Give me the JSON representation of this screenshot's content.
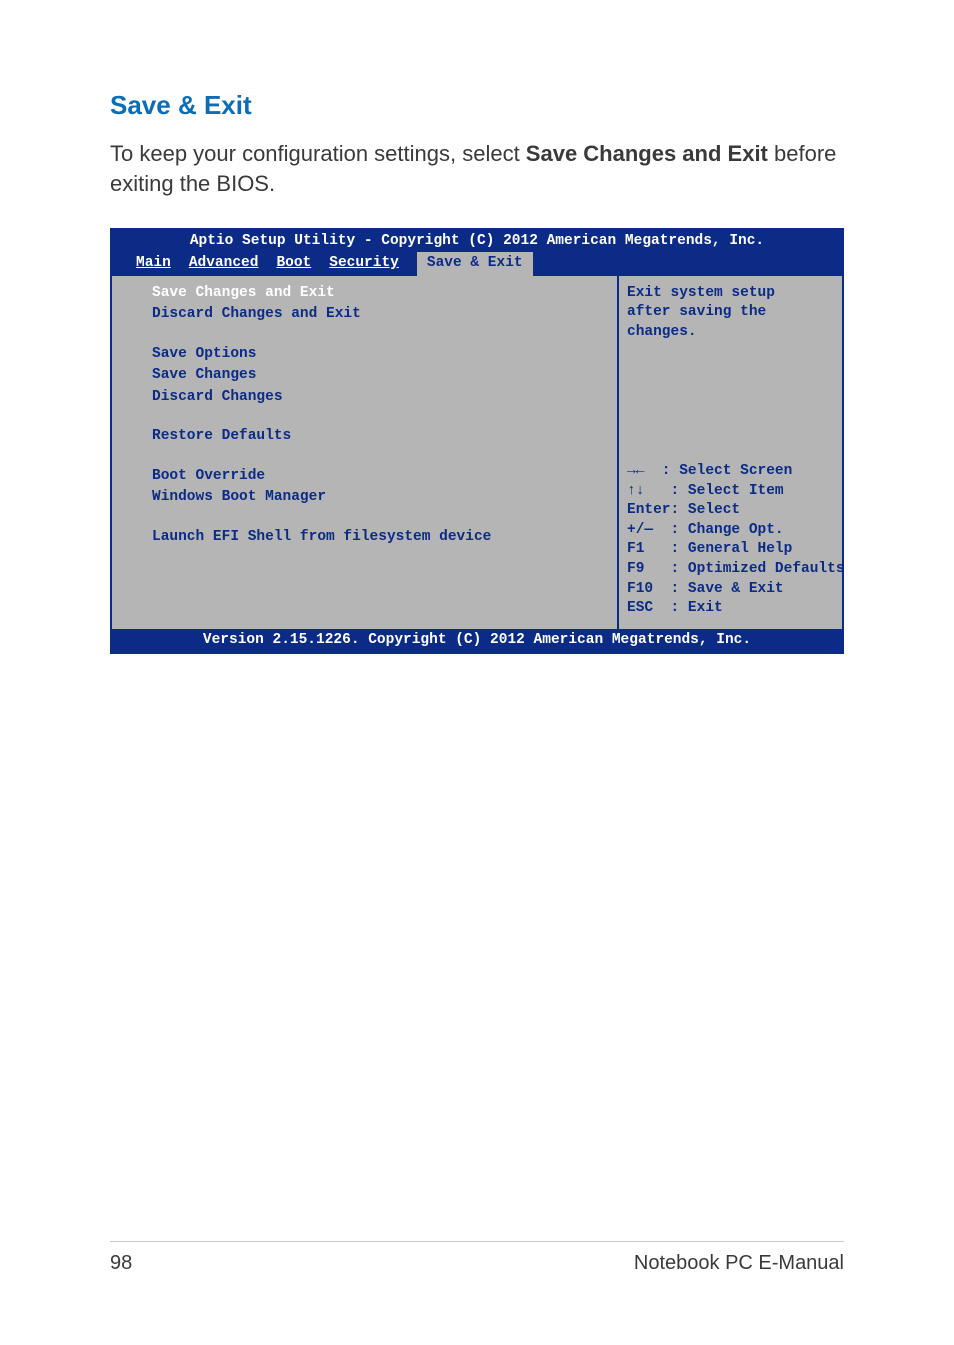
{
  "heading": "Save & Exit",
  "body_text_before": "To keep your configuration settings, select ",
  "body_text_bold": "Save Changes and Exit",
  "body_text_after": " before exiting the BIOS.",
  "bios": {
    "title": "Aptio Setup Utility - Copyright (C) 2012 American Megatrends, Inc.",
    "tabs": [
      "Main",
      "Advanced",
      "Boot",
      "Security",
      "Save & Exit"
    ],
    "active_tab_index": 4,
    "left": {
      "selected": "Save Changes and Exit",
      "items": [
        "Discard Changes and Exit",
        "",
        "Save Options",
        "Save Changes",
        "Discard Changes",
        "",
        "Restore Defaults",
        "",
        "Boot Override",
        "Windows Boot Manager",
        "",
        "Launch EFI Shell from filesystem device"
      ]
    },
    "right": {
      "help_line1": "Exit system setup",
      "help_line2": "after saving the",
      "help_line3": "changes.",
      "keys": [
        "→←  : Select Screen",
        "↑↓   : Select Item",
        "Enter: Select",
        "+/—  : Change Opt.",
        "F1   : General Help",
        "F9   : Optimized Defaults",
        "F10  : Save & Exit",
        "ESC  : Exit"
      ]
    },
    "footer": "Version 2.15.1226. Copyright (C) 2012 American Megatrends, Inc."
  },
  "footer": {
    "page_number": "98",
    "doc_title": "Notebook PC E-Manual"
  }
}
